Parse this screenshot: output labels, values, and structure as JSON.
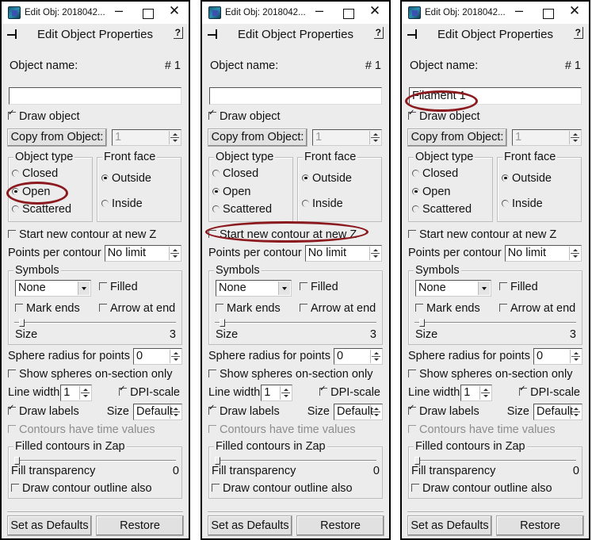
{
  "panels": [
    {
      "window_title": "Edit Obj: 2018042...",
      "header": "Edit Object Properties",
      "help_label": "?",
      "object_name_label": "Object name:",
      "object_number": "# 1",
      "object_name_value": "",
      "draw_object_label": "Draw object",
      "draw_object_checked": true,
      "copy_from_label": "Copy from Object:",
      "copy_from_value": "1",
      "object_type_legend": "Object type",
      "object_type_options": [
        "Closed",
        "Open",
        "Scattered"
      ],
      "object_type_selected": "Open",
      "front_face_legend": "Front face",
      "front_face_options": [
        "Outside",
        "Inside"
      ],
      "front_face_selected": "Outside",
      "start_new_contour_label": "Start new contour at new Z",
      "points_per_contour_label": "Points per contour",
      "points_per_contour_value": "No limit",
      "symbols_legend": "Symbols",
      "symbol_value": "None",
      "filled_label": "Filled",
      "mark_ends_label": "Mark ends",
      "arrow_at_end_label": "Arrow at end",
      "size_label": "Size",
      "size_value": "3",
      "sphere_radius_label": "Sphere radius for points",
      "sphere_radius_value": "0",
      "show_spheres_label": "Show spheres on-section only",
      "line_width_label": "Line width",
      "line_width_value": "1",
      "dpi_scale_label": "DPI-scale",
      "draw_labels_label": "Draw labels",
      "label_size_label": "Size",
      "label_size_value": "Default",
      "contours_time_label": "Contours have time values",
      "filled_contours_legend": "Filled contours in Zap",
      "fill_transparency_label": "Fill transparency",
      "fill_transparency_value": "0",
      "draw_outline_label": "Draw contour outline also",
      "set_defaults_label": "Set as Defaults",
      "restore_label": "Restore",
      "highlight": "object-type-open"
    },
    {
      "window_title": "Edit Obj: 2018042...",
      "header": "Edit Object Properties",
      "help_label": "?",
      "object_name_label": "Object name:",
      "object_number": "# 1",
      "object_name_value": "",
      "draw_object_label": "Draw object",
      "draw_object_checked": true,
      "copy_from_label": "Copy from Object:",
      "copy_from_value": "1",
      "object_type_legend": "Object type",
      "object_type_options": [
        "Closed",
        "Open",
        "Scattered"
      ],
      "object_type_selected": "Open",
      "front_face_legend": "Front face",
      "front_face_options": [
        "Outside",
        "Inside"
      ],
      "front_face_selected": "Outside",
      "start_new_contour_label": "Start new contour at new Z",
      "points_per_contour_label": "Points per contour",
      "points_per_contour_value": "No limit",
      "symbols_legend": "Symbols",
      "symbol_value": "None",
      "filled_label": "Filled",
      "mark_ends_label": "Mark ends",
      "arrow_at_end_label": "Arrow at end",
      "size_label": "Size",
      "size_value": "3",
      "sphere_radius_label": "Sphere radius for points",
      "sphere_radius_value": "0",
      "show_spheres_label": "Show spheres on-section only",
      "line_width_label": "Line width",
      "line_width_value": "1",
      "dpi_scale_label": "DPI-scale",
      "draw_labels_label": "Draw labels",
      "label_size_label": "Size",
      "label_size_value": "Default",
      "contours_time_label": "Contours have time values",
      "filled_contours_legend": "Filled contours in Zap",
      "fill_transparency_label": "Fill transparency",
      "fill_transparency_value": "0",
      "draw_outline_label": "Draw contour outline also",
      "set_defaults_label": "Set as Defaults",
      "restore_label": "Restore",
      "highlight": "start-new-contour"
    },
    {
      "window_title": "Edit Obj: 2018042...",
      "header": "Edit Object Properties",
      "help_label": "?",
      "object_name_label": "Object name:",
      "object_number": "# 1",
      "object_name_value": "Filament 1",
      "draw_object_label": "Draw object",
      "draw_object_checked": true,
      "copy_from_label": "Copy from Object:",
      "copy_from_value": "1",
      "object_type_legend": "Object type",
      "object_type_options": [
        "Closed",
        "Open",
        "Scattered"
      ],
      "object_type_selected": "Open",
      "front_face_legend": "Front face",
      "front_face_options": [
        "Outside",
        "Inside"
      ],
      "front_face_selected": "Outside",
      "start_new_contour_label": "Start new contour at new Z",
      "points_per_contour_label": "Points per contour",
      "points_per_contour_value": "No limit",
      "symbols_legend": "Symbols",
      "symbol_value": "None",
      "filled_label": "Filled",
      "mark_ends_label": "Mark ends",
      "arrow_at_end_label": "Arrow at end",
      "size_label": "Size",
      "size_value": "3",
      "sphere_radius_label": "Sphere radius for points",
      "sphere_radius_value": "0",
      "show_spheres_label": "Show spheres on-section only",
      "line_width_label": "Line width",
      "line_width_value": "1",
      "dpi_scale_label": "DPI-scale",
      "draw_labels_label": "Draw labels",
      "label_size_label": "Size",
      "label_size_value": "Default",
      "contours_time_label": "Contours have time values",
      "filled_contours_legend": "Filled contours in Zap",
      "fill_transparency_label": "Fill transparency",
      "fill_transparency_value": "0",
      "draw_outline_label": "Draw contour outline also",
      "set_defaults_label": "Set as Defaults",
      "restore_label": "Restore",
      "highlight": "object-name"
    }
  ],
  "annotation_color": "#8b1a1f",
  "size_slider_fraction": 0.03,
  "fill_transparency_fraction": 0.0
}
